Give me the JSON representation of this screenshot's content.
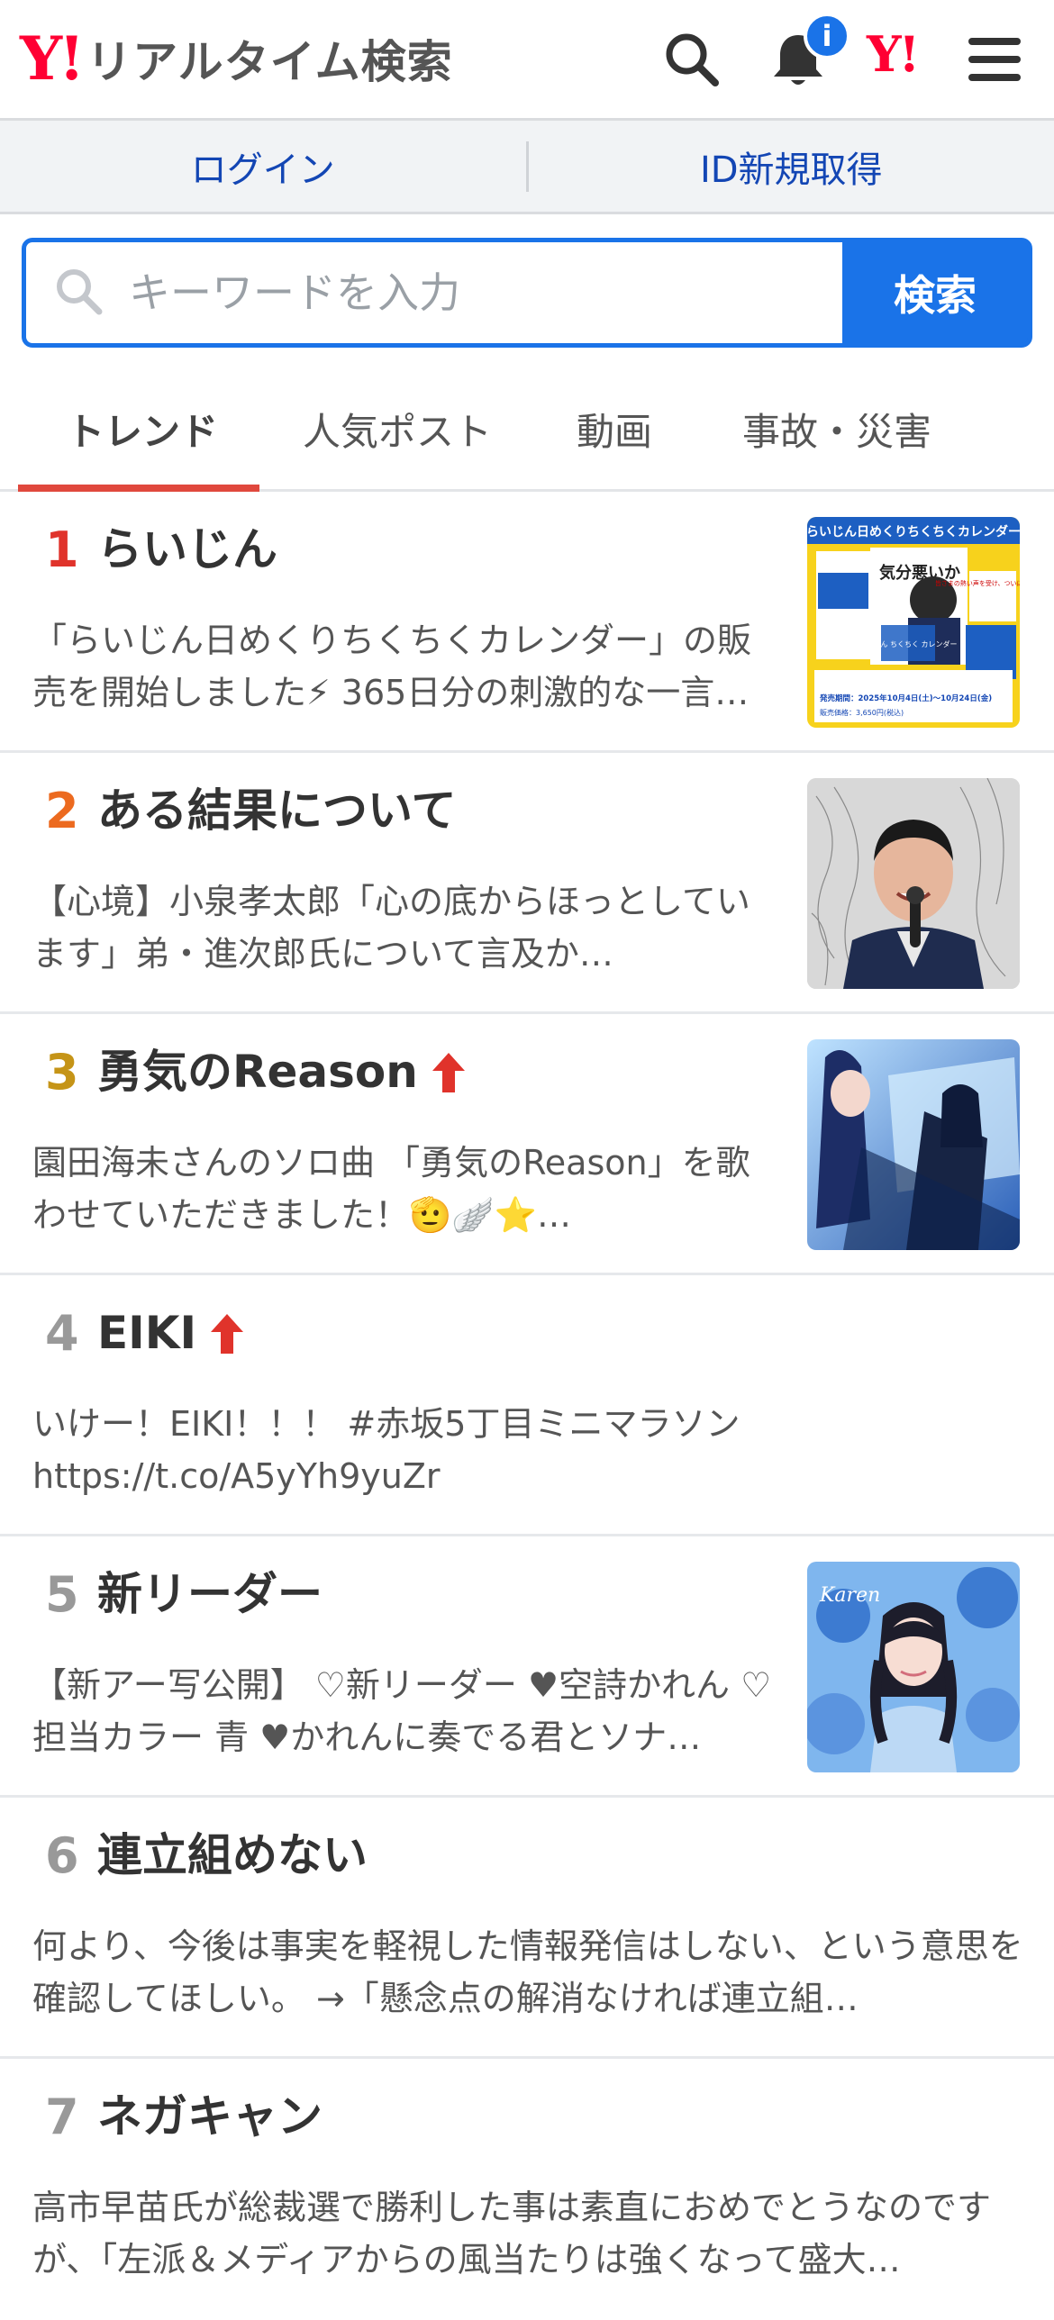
{
  "header": {
    "logo_mark": "Y!",
    "logo_text": "リアルタイム検索",
    "notification_badge": "i",
    "yj_mark": "Y!"
  },
  "login_bar": {
    "login": "ログイン",
    "signup": "ID新規取得"
  },
  "search": {
    "placeholder": "キーワードを入力",
    "button": "検索"
  },
  "tabs": [
    {
      "label": "トレンド",
      "active": true
    },
    {
      "label": "人気ポスト"
    },
    {
      "label": "動画"
    },
    {
      "label": "事故・災害"
    }
  ],
  "trends": [
    {
      "rank": "1",
      "title": "らいじん",
      "rising": false,
      "desc": "「らいじん日めくりちくちくカレンダー」の販売を開始しました⚡ 365日分の刺激的な一言…",
      "thumbnail": {
        "banner": "らいじん日めくりちくちくカレンダー",
        "text_1": "気分悪いか",
        "text_2": "皆さまの熱い声を受け、ついに商品化!!",
        "text_3": "らいじん ちくちく カレンダー",
        "period": "発売期間：2025年10月4日(土)〜10月24日(金)",
        "price": "販売価格：3,650円(税込)"
      }
    },
    {
      "rank": "2",
      "title": "ある結果について",
      "rising": false,
      "desc": "【心境】小泉孝太郎「心の底からほっとしています」弟・進次郎氏について言及か…"
    },
    {
      "rank": "3",
      "title": "勇気のReason",
      "rising": true,
      "desc": "園田海未さんのソロ曲 「勇気のReason」を歌わせていただきました！🫡🪽⭐…"
    },
    {
      "rank": "4",
      "title": "EIKI",
      "rising": true,
      "desc": "いけー！EIKI！！！ #赤坂5丁目ミニマラソン https://t.co/A5yYh9yuZr"
    },
    {
      "rank": "5",
      "title": "新リーダー",
      "rising": false,
      "desc": "【新アー写公開】 ♡新リーダー ♥空詩かれん ♡担当カラー 青 ♥かれんに奏でる君とソナ…",
      "thumbnail": {
        "caption": "Karen"
      }
    },
    {
      "rank": "6",
      "title": "連立組めない",
      "rising": false,
      "desc": "何より、今後は事実を軽視した情報発信はしない、という意思を確認してほしい。 →「懸念点の解消なければ連立組…"
    },
    {
      "rank": "7",
      "title": "ネガキャン",
      "rising": false,
      "desc": "高市早苗氏が総裁選で勝利した事は素直におめでとうなのですが、「左派＆メディアからの風当たりは強くなって盛大…"
    }
  ],
  "colors": {
    "accent_red": "#e0483d",
    "rank1": "#e0332b",
    "rank2": "#ec6a1f",
    "rank3": "#c59417",
    "rank_other": "#999999",
    "link_blue": "#1346b4",
    "primary_blue": "#1a73e8",
    "rising_arrow": "#e0332b"
  }
}
